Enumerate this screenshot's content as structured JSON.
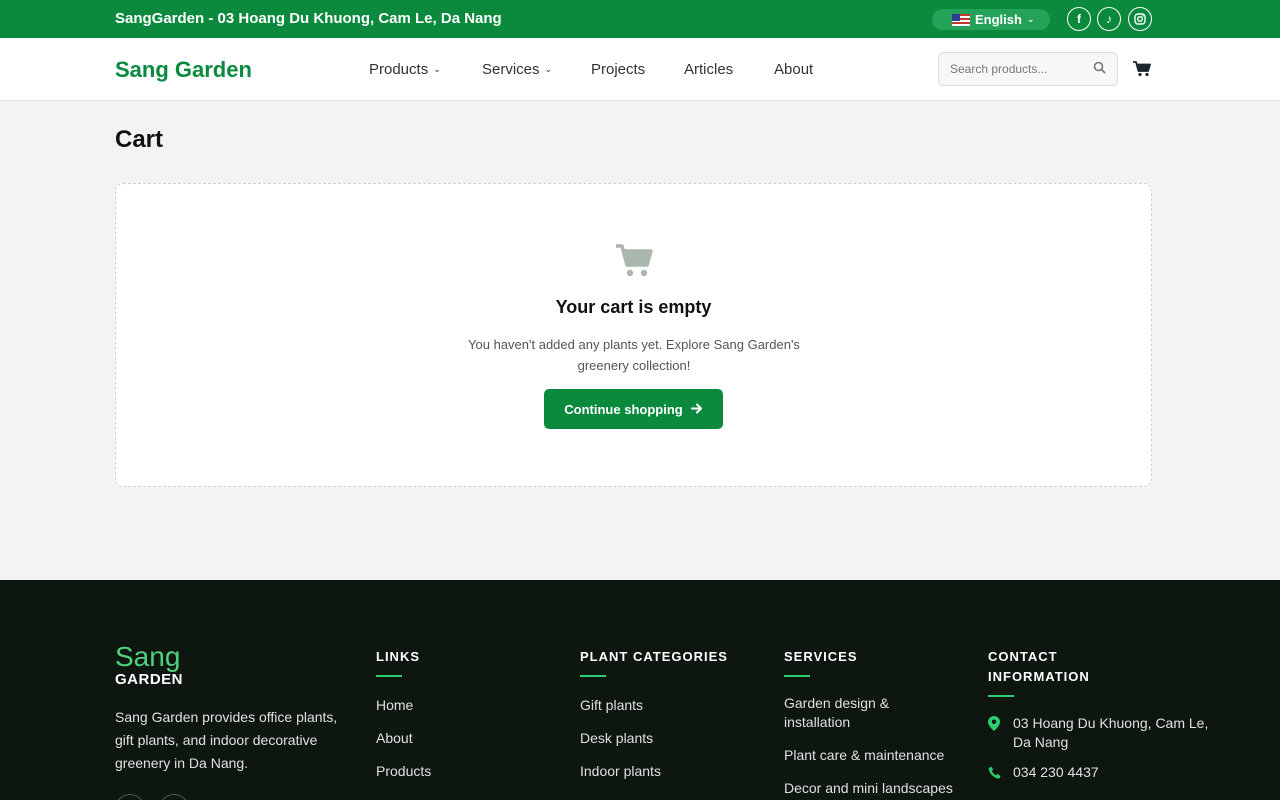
{
  "topbar": {
    "address": "SangGarden - 03 Hoang Du Khuong, Cam Le, Da Nang",
    "language": "English",
    "social_icons": [
      "facebook-icon",
      "tiktok-icon",
      "instagram-icon"
    ]
  },
  "header": {
    "logo": "Sang Garden",
    "nav": [
      {
        "label": "Products",
        "dropdown": true
      },
      {
        "label": "Services",
        "dropdown": true
      },
      {
        "label": "Projects",
        "dropdown": false
      },
      {
        "label": "Articles",
        "dropdown": false
      },
      {
        "label": "About",
        "dropdown": false
      }
    ],
    "search_placeholder": "Search products..."
  },
  "main": {
    "title": "Cart",
    "empty_title": "Your cart is empty",
    "empty_message": "You haven't added any plants yet. Explore Sang Garden's greenery collection!",
    "continue_label": "Continue shopping"
  },
  "footer": {
    "logo_top": "Sang",
    "logo_bottom": "GARDEN",
    "description": "Sang Garden provides office plants, gift plants, and indoor decorative greenery in Da Nang.",
    "links_heading": "LINKS",
    "links": [
      "Home",
      "About",
      "Products"
    ],
    "categories_heading": "PLANT CATEGORIES",
    "categories": [
      "Gift plants",
      "Desk plants",
      "Indoor plants"
    ],
    "services_heading": "SERVICES",
    "services": [
      "Garden design & installation",
      "Plant care & maintenance",
      "Decor and mini landscapes"
    ],
    "contact_heading": "CONTACT INFORMATION",
    "contact_address": "03 Hoang Du Khuong, Cam Le, Da Nang",
    "contact_phone": "034 230 4437"
  },
  "colors": {
    "brand_green": "#0b8a3e",
    "footer_bg": "#0d1710",
    "accent_green": "#2ecc71"
  }
}
